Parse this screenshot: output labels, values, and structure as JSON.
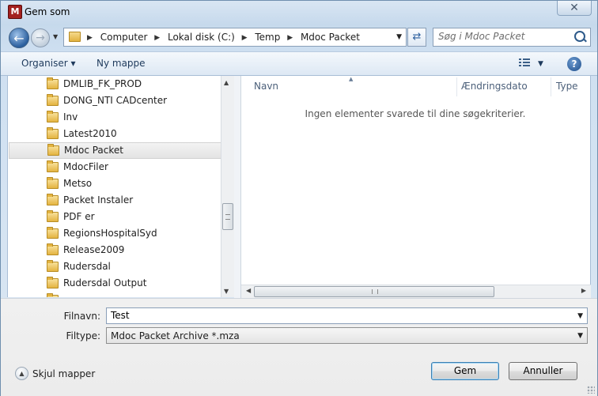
{
  "window": {
    "title": "Gem som",
    "app_icon_letter": "M",
    "close_glyph": "✕"
  },
  "nav": {
    "breadcrumbs": [
      "Computer",
      "Lokal disk (C:)",
      "Temp",
      "Mdoc Packet"
    ],
    "search_placeholder": "Søg i Mdoc Packet"
  },
  "toolbar": {
    "organise_label": "Organiser ▾",
    "new_folder_label": "Ny mappe",
    "help_label": "?"
  },
  "folders": [
    {
      "label": "DMLIB_FK_PROD",
      "selected": false
    },
    {
      "label": "DONG_NTI CADcenter",
      "selected": false
    },
    {
      "label": "Inv",
      "selected": false
    },
    {
      "label": "Latest2010",
      "selected": false
    },
    {
      "label": "Mdoc Packet",
      "selected": true
    },
    {
      "label": "MdocFiler",
      "selected": false
    },
    {
      "label": "Metso",
      "selected": false
    },
    {
      "label": "Packet Instaler",
      "selected": false
    },
    {
      "label": "PDF er",
      "selected": false
    },
    {
      "label": "RegionsHospitalSyd",
      "selected": false
    },
    {
      "label": "Release2009",
      "selected": false
    },
    {
      "label": "Rudersdal",
      "selected": false
    },
    {
      "label": "Rudersdal Output",
      "selected": false
    }
  ],
  "file_list": {
    "columns": [
      "Navn",
      "Ændringsdato",
      "Type"
    ],
    "empty_message": "Ingen elementer svarede til dine søgekriterier."
  },
  "form": {
    "filename_label": "Filnavn:",
    "filename_value": "Test",
    "filetype_label": "Filtype:",
    "filetype_value": "Mdoc Packet Archive *.mza"
  },
  "footer": {
    "hide_folders_label": "Skjul mapper",
    "save_label": "Gem",
    "cancel_label": "Annuller"
  }
}
